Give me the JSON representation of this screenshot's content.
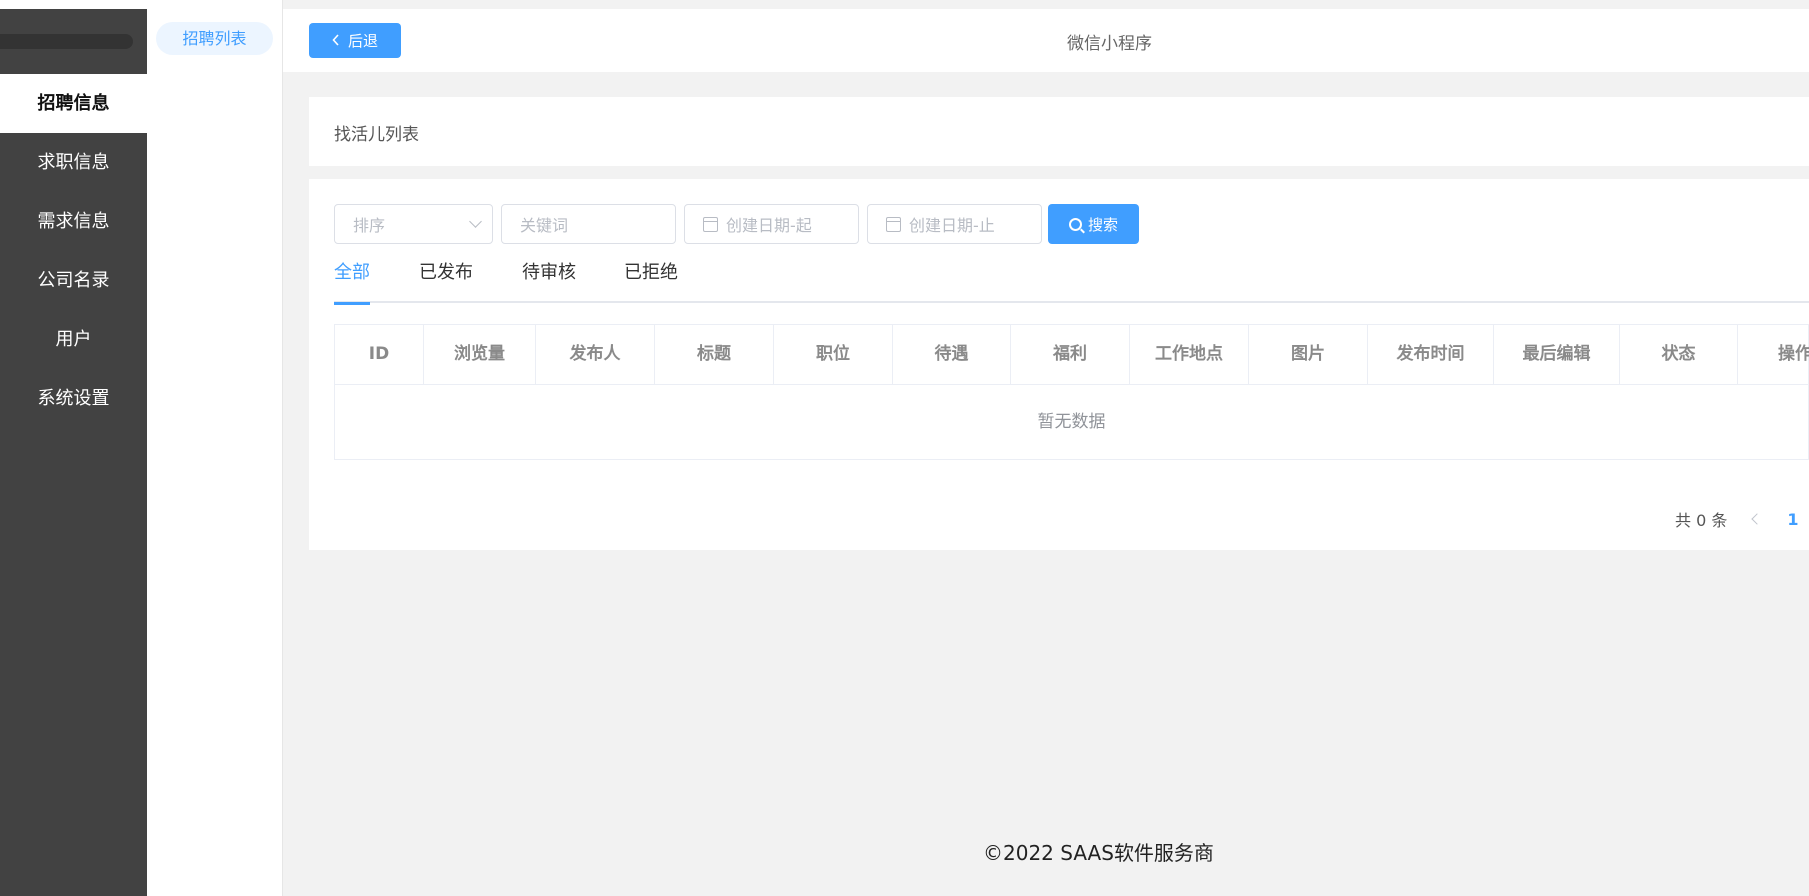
{
  "sidebar": {
    "items": [
      {
        "label": "招聘信息",
        "active": true
      },
      {
        "label": "求职信息"
      },
      {
        "label": "需求信息"
      },
      {
        "label": "公司名录"
      },
      {
        "label": "用户"
      },
      {
        "label": "系统设置"
      }
    ]
  },
  "subnav": {
    "active_label": "招聘列表"
  },
  "header": {
    "back_label": "后退",
    "title": "微信小程序"
  },
  "card_title": "找活儿列表",
  "filters": {
    "sort_placeholder": "排序",
    "keyword_placeholder": "关键词",
    "date_start_placeholder": "创建日期-起",
    "date_end_placeholder": "创建日期-止",
    "search_label": "搜索"
  },
  "tabs": [
    {
      "label": "全部",
      "active": true
    },
    {
      "label": "已发布"
    },
    {
      "label": "待审核"
    },
    {
      "label": "已拒绝"
    }
  ],
  "table": {
    "columns": [
      "ID",
      "浏览量",
      "发布人",
      "标题",
      "职位",
      "待遇",
      "福利",
      "工作地点",
      "图片",
      "发布时间",
      "最后编辑",
      "状态",
      "操作"
    ],
    "empty_text": "暂无数据"
  },
  "pagination": {
    "total_text": "共 0 条",
    "current_page": "1"
  },
  "footer": "©2022 SAAS软件服务商",
  "colors": {
    "primary": "#409eff",
    "sidebar_bg": "#424242"
  }
}
